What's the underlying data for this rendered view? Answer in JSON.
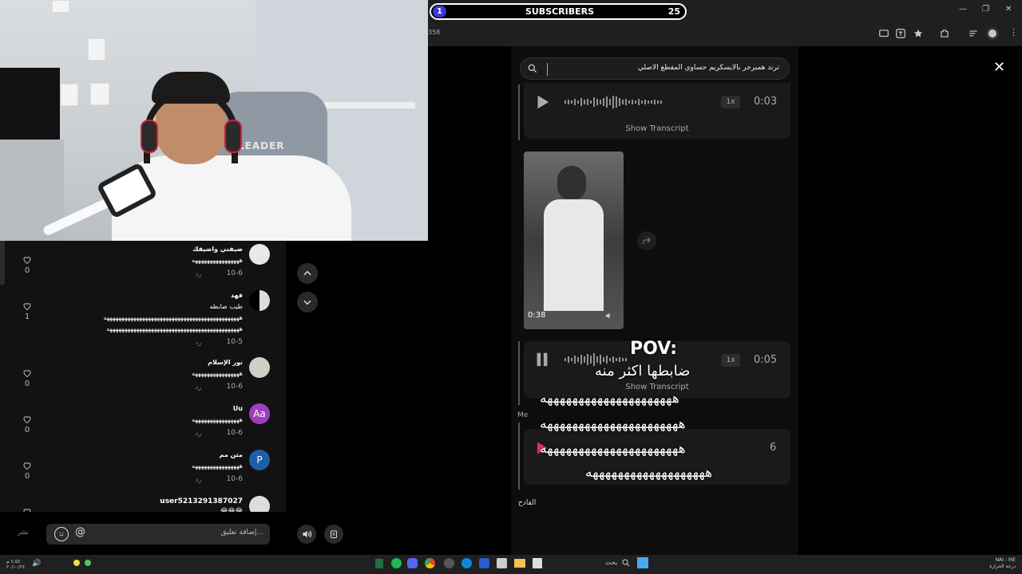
{
  "overlay_bar": {
    "rank": "1",
    "label": "SUBSCRIBERS",
    "count": "25"
  },
  "browser": {
    "url_fragment": "358"
  },
  "search": {
    "query": "ترند همبرجر بالايسكريم حساوي المقطع الاصلي"
  },
  "feed": {
    "audio1": {
      "speed": "1x",
      "duration": "0:03",
      "transcript": "Show Transcript"
    },
    "video": {
      "duration": "0:38"
    },
    "audio2": {
      "speed": "1x",
      "duration": "0:05",
      "transcript": "Show Transcript"
    },
    "me_label": "Me",
    "audio3_duration": "6",
    "sender": "القادح",
    "overlay": {
      "title": "POV:",
      "subtitle": "ضابطها اكثر منه",
      "lines": [
        "هههههههههههههههههههههه",
        "ههههههههههههههههههههههه",
        "ههههههههههههههههههههههه",
        "هههههههههههههههههههه"
      ]
    }
  },
  "chair_logo": "LEADER",
  "comments": [
    {
      "user": "ضيفني واضيفك",
      "text": "ههههههههههههههههه",
      "date": "10-6",
      "reply": "رد",
      "likes": "0"
    },
    {
      "user": "فهد",
      "text": "طيب ضابطه\nههههههههههههههههههههههههههههههههههههههههههههههه\nهههههههههههههههههههههههههههههههههههههههههههههه",
      "date": "10-5",
      "reply": "رد",
      "likes": "1"
    },
    {
      "user": "نور الإسلام",
      "text": "ههههههههههههههههه",
      "date": "10-6",
      "reply": "رد",
      "likes": "0"
    },
    {
      "user": "Uu",
      "avatar_text": "Aa",
      "text": "ههههههههههههههههه",
      "date": "10-6",
      "reply": "رد",
      "likes": "0"
    },
    {
      "user": "مثن مم",
      "avatar_text": "P",
      "text": "ههههههههههههههههه",
      "date": "10-6",
      "reply": "رد",
      "likes": "0"
    },
    {
      "user": "user5213291387027",
      "text": "😂😂😂",
      "date": "",
      "reply": "",
      "likes": ""
    }
  ],
  "composer": {
    "placeholder": "إضافة تعليق...",
    "side_label": "نشر"
  },
  "taskbar": {
    "search_label": "بحث",
    "lang_top": "NAI - ME",
    "lang_bottom": "درجة الحرارة",
    "time": "٤:٥٤ م",
    "date": "٢٠/١٠/٢٤"
  }
}
